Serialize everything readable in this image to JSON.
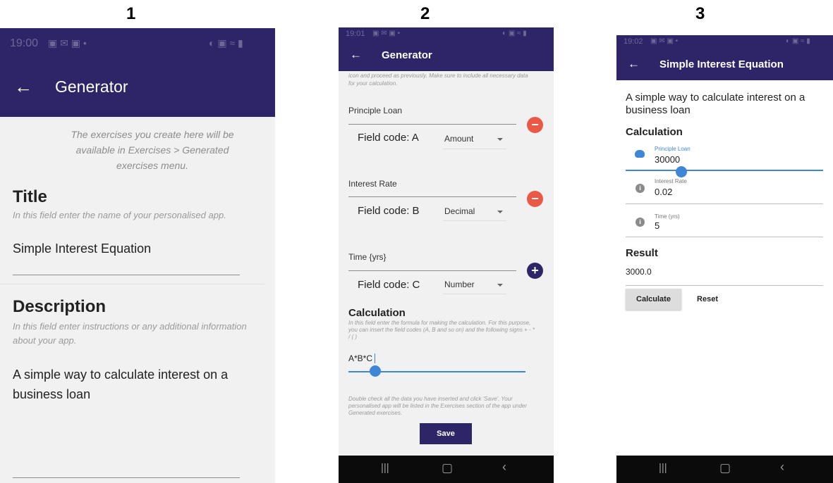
{
  "labels": [
    "1",
    "2",
    "3"
  ],
  "colors": {
    "appbar": "#2e2569",
    "remove": "#ec5846",
    "add": "#2e2569",
    "slider": "#3f87d6"
  },
  "screen1": {
    "status_time": "19:00",
    "title": "Generator",
    "intro": "The exercises you create here will be available in Exercises > Generated exercises menu.",
    "title_heading": "Title",
    "title_hint": "In this field enter the name of your personalised app.",
    "title_value": "Simple Interest Equation",
    "desc_heading": "Description",
    "desc_hint": "In this field enter instructions or any additional information about your app.",
    "desc_value": "A simple way to calculate interest on a business loan"
  },
  "screen2": {
    "status_time": "19:01",
    "title": "Generator",
    "top_text": "icon and proceed as previously. Make sure to include all necessary data for your calculation.",
    "fields": [
      {
        "name": "Principle Loan",
        "code_label": "Field code: A",
        "type": "Amount",
        "action_icon": "remove-icon"
      },
      {
        "name": "Interest Rate",
        "code_label": "Field code: B",
        "type": "Decimal",
        "action_icon": "remove-icon"
      },
      {
        "name": "Time {yrs}",
        "code_label": "Field code: C",
        "type": "Number",
        "action_icon": "add-icon"
      }
    ],
    "calc_heading": "Calculation",
    "calc_hint": "In this field enter the formula for making the calculation. For this purpose, you can insert the field codes (A, B and so on) and the following signs + - * / ( )",
    "formula": "A*B*C",
    "footer_text": "Double check all the data you have inserted and click 'Save'. Your personalised app will be listed in the Exercises section of the app under Generated exercises.",
    "save_label": "Save"
  },
  "screen3": {
    "status_time": "19:02",
    "title": "Simple Interest Equation",
    "description": "A simple way to calculate interest on a business loan",
    "calc_heading": "Calculation",
    "inputs": [
      {
        "label": "Principle Loan",
        "value": "30000",
        "icon": "piggy-bank-icon"
      },
      {
        "label": "Interest Rate",
        "value": "0.02",
        "icon": "info-icon"
      },
      {
        "label": "Time (yrs)",
        "value": "5",
        "icon": "info-icon"
      }
    ],
    "result_heading": "Result",
    "result_value": "3000.0",
    "calculate_label": "Calculate",
    "reset_label": "Reset"
  }
}
